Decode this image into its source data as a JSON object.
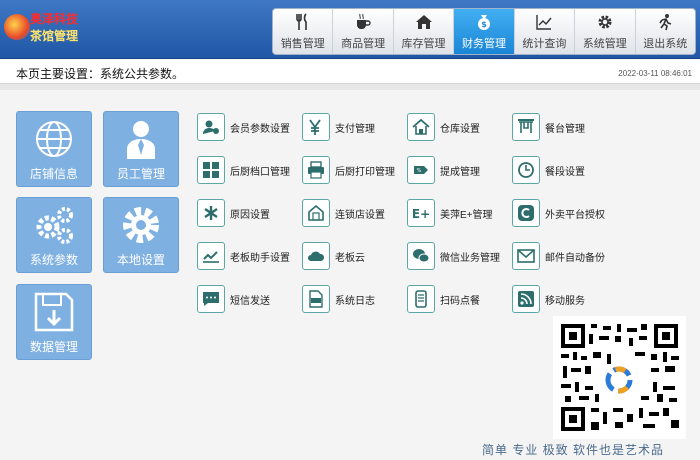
{
  "app": {
    "logo_line1": "奥泽科技",
    "logo_line2": "茶馆管理"
  },
  "topnav": [
    {
      "label": "销售管理",
      "icon": "utensils-icon",
      "glyph": "🍴",
      "active": false
    },
    {
      "label": "商品管理",
      "icon": "coffee-cup-icon",
      "glyph": "☕",
      "active": false
    },
    {
      "label": "库存管理",
      "icon": "home-icon",
      "glyph": "⌂",
      "active": false
    },
    {
      "label": "财务管理",
      "icon": "money-bag-icon",
      "glyph": "$",
      "active": true
    },
    {
      "label": "统计查询",
      "icon": "line-chart-icon",
      "glyph": "📈",
      "active": false
    },
    {
      "label": "系统管理",
      "icon": "gear-icon",
      "glyph": "⚙",
      "active": false
    },
    {
      "label": "退出系统",
      "icon": "exit-runner-icon",
      "glyph": "🏃",
      "active": false
    }
  ],
  "subbar": {
    "title": "本页主要设置：系统公共参数。",
    "datetime": "2022-03-11 08:46:01"
  },
  "tiles": [
    {
      "label": "店铺信息",
      "icon": "globe-icon"
    },
    {
      "label": "员工管理",
      "icon": "employee-icon"
    },
    {
      "label": "系统参数",
      "icon": "gears-icon"
    },
    {
      "label": "本地设置",
      "icon": "gear-icon"
    },
    {
      "label": "数据管理",
      "icon": "floppy-disk-icon"
    }
  ],
  "grid": [
    {
      "label": "会员参数设置",
      "icon": "member-settings-icon"
    },
    {
      "label": "支付管理",
      "icon": "yen-payment-icon"
    },
    {
      "label": "仓库设置",
      "icon": "warehouse-icon"
    },
    {
      "label": "餐台管理",
      "icon": "dining-table-icon"
    },
    {
      "label": "后厨档口管理",
      "icon": "grid-icon"
    },
    {
      "label": "后厨打印管理",
      "icon": "printer-icon"
    },
    {
      "label": "提成管理",
      "icon": "commission-icon"
    },
    {
      "label": "餐段设置",
      "icon": "clock-icon"
    },
    {
      "label": "原因设置",
      "icon": "asterisk-icon"
    },
    {
      "label": "连锁店设置",
      "icon": "chain-store-icon"
    },
    {
      "label": "美萍E+管理",
      "icon": "e-plus-icon"
    },
    {
      "label": "外卖平台授权",
      "icon": "delivery-platform-icon"
    },
    {
      "label": "老板助手设置",
      "icon": "boss-assistant-icon"
    },
    {
      "label": "老板云",
      "icon": "cloud-icon"
    },
    {
      "label": "微信业务管理",
      "icon": "wechat-icon"
    },
    {
      "label": "邮件自动备份",
      "icon": "mail-icon"
    },
    {
      "label": "短信发送",
      "icon": "sms-icon"
    },
    {
      "label": "系统日志",
      "icon": "log-file-icon"
    },
    {
      "label": "扫码点餐",
      "icon": "phone-scan-icon"
    },
    {
      "label": "移动服务",
      "icon": "rss-icon"
    }
  ],
  "footer": {
    "slogan": "简单  专业  极致  软件也是艺术品"
  }
}
